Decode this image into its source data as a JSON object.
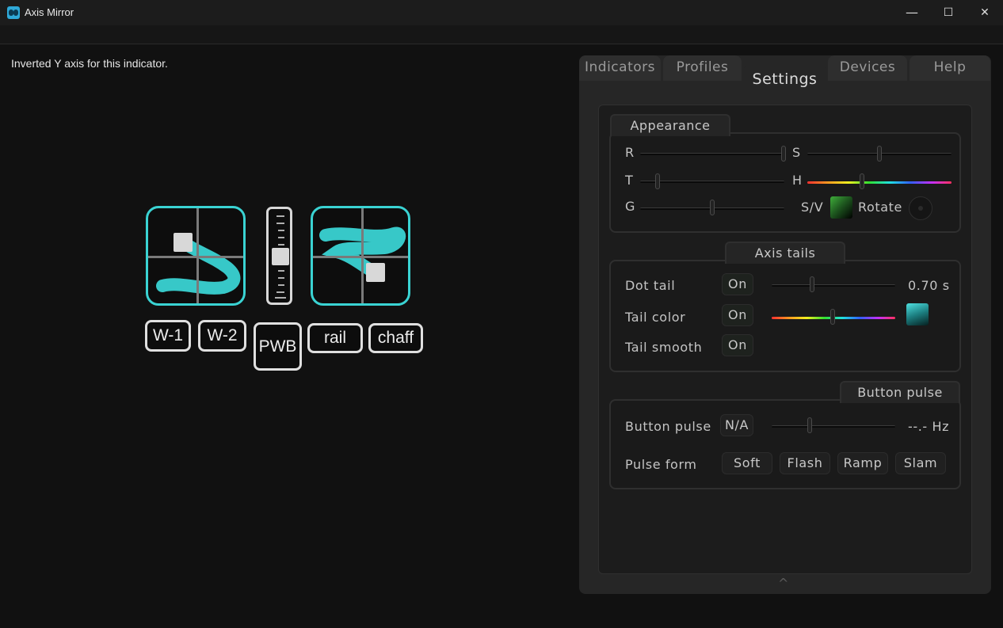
{
  "window": {
    "title": "Axis Mirror",
    "minimize_glyph": "—",
    "maximize_glyph": "☐",
    "close_glyph": "✕"
  },
  "status": {
    "text": "Inverted Y axis for this indicator."
  },
  "indicators": {
    "buttons": [
      "W-1",
      "W-2",
      "PWB",
      "rail",
      "chaff"
    ],
    "accent_color": "#3ad3d3"
  },
  "tabs": {
    "indicators": "Indicators",
    "profiles": "Profiles",
    "settings": "Settings",
    "devices": "Devices",
    "help": "Help",
    "active": "Settings"
  },
  "appearance": {
    "title": "Appearance",
    "r_label": "R",
    "s_label": "S",
    "t_label": "T",
    "h_label": "H",
    "g_label": "G",
    "sv_label": "S/V",
    "rotate_label": "Rotate",
    "r_value": 1.0,
    "s_value": 0.5,
    "t_value": 0.12,
    "h_value": 0.38,
    "g_value": 0.5
  },
  "axis_tails": {
    "title": "Axis tails",
    "dot_tail_label": "Dot tail",
    "dot_tail_state": "On",
    "dot_tail_value": "0.70 s",
    "tail_color_label": "Tail color",
    "tail_color_state": "On",
    "tail_smooth_label": "Tail smooth",
    "tail_smooth_state": "On"
  },
  "button_pulse": {
    "title": "Button pulse",
    "pulse_label": "Button pulse",
    "pulse_state": "N/A",
    "pulse_value": "--.- Hz",
    "form_label": "Pulse form",
    "forms": [
      "Soft",
      "Flash",
      "Ramp",
      "Slam"
    ]
  },
  "footer": {
    "collapse_glyph": "^"
  }
}
